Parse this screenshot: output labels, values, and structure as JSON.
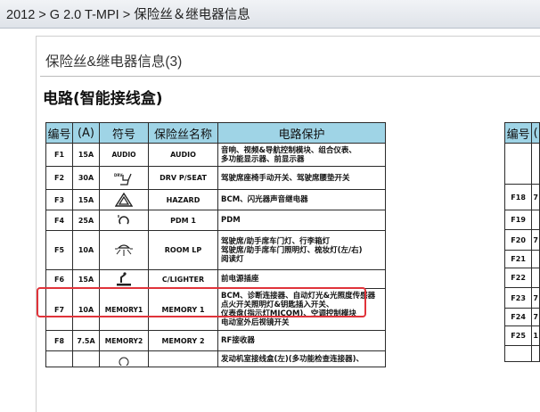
{
  "breadcrumb": "2012 > G 2.0 T-MPI > 保险丝＆继电器信息",
  "section_title": "保险丝&继电器信息(3)",
  "subtitle": "电路(智能接线盒)",
  "headers": {
    "num": "编号",
    "amp": "(A)",
    "symbol": "符号",
    "fuse_name": "保险丝名称",
    "protection": "电路保护",
    "right_num": "编号",
    "right_next": "("
  },
  "rows": [
    {
      "num": "F1",
      "amp": "15A",
      "symbol": "AUDIO",
      "name": "AUDIO",
      "desc": "音响、视频&导航控制模块、组合仪表、\n多功能显示器、前显示器"
    },
    {
      "num": "F2",
      "amp": "30A",
      "symbol": "drv-seat-icon",
      "name": "DRV P/SEAT",
      "desc": "驾驶席座椅手动开关、驾驶席腰垫开关"
    },
    {
      "num": "F3",
      "amp": "15A",
      "symbol": "hazard-icon",
      "name": "HAZARD",
      "desc": "BCM、闪光器声音继电器"
    },
    {
      "num": "F4",
      "amp": "25A",
      "symbol": "pdm-icon",
      "name": "PDM 1",
      "desc": "PDM"
    },
    {
      "num": "F5",
      "amp": "10A",
      "symbol": "room-lamp-icon",
      "name": "ROOM LP",
      "desc": "驾驶席/助手席车门灯、行李箱灯\n驾驶席/助手席车门照明灯、梳妆灯(左/右)\n阅读灯"
    },
    {
      "num": "F6",
      "amp": "15A",
      "symbol": "cigar-lighter-icon",
      "name": "C/LIGHTER",
      "desc": "前电源插座"
    },
    {
      "num": "F7",
      "amp": "10A",
      "symbol": "MEMORY1",
      "name": "MEMORY 1",
      "desc": "BCM、诊断连接器、自动灯光&光照度传感器\n点火开关照明灯&钥匙插入开关、\n仪表盘(指示灯MICOM)、空调控制模块\n电动室外后视镜开关"
    },
    {
      "num": "F8",
      "amp": "7.5A",
      "symbol": "MEMORY2",
      "name": "MEMORY 2",
      "desc": "RF接收器"
    },
    {
      "num": "",
      "amp": "",
      "symbol": "partial-icon",
      "name": "",
      "desc": "发动机室接线盒(左)(多功能检查连接器)、"
    }
  ],
  "right_rows": [
    {
      "num": "",
      "next": ""
    },
    {
      "num": "F18",
      "next": "7"
    },
    {
      "num": "F19",
      "next": ""
    },
    {
      "num": "F20",
      "next": "7"
    },
    {
      "num": "F21",
      "next": ""
    },
    {
      "num": "F22",
      "next": ""
    },
    {
      "num": "F23",
      "next": "7"
    },
    {
      "num": "F24",
      "next": "7"
    },
    {
      "num": "F25",
      "next": "1"
    },
    {
      "num": "",
      "next": ""
    }
  ],
  "colors": {
    "header_bg": "#9fd4e6",
    "highlight": "#e0333a",
    "topbar": "#e6e9ee"
  }
}
